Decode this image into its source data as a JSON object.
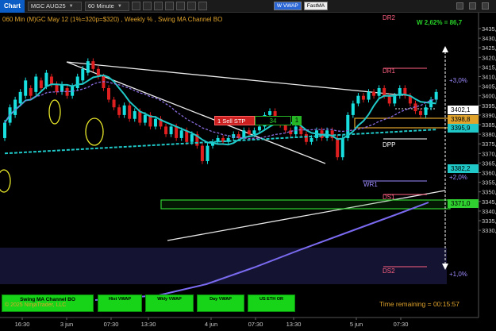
{
  "toolbar": {
    "title": "Chart",
    "instrument": "MGC AUG25",
    "timeframe": "60 Minute",
    "pill_a": "W VWAP",
    "pill_b": "FastMA"
  },
  "status_line": "060 Min  (M)GC May 12 (1%=320p=$320) , Weekly % , Swing MA Channel BO",
  "stats": "W 2,62% = 86,7",
  "order": {
    "sell_label": "1  Sell STP",
    "quantity": "34",
    "badge": "1"
  },
  "price_axis": {
    "labels": [
      "3435,0",
      "3430,0",
      "3425,0",
      "3420,0",
      "3415,0",
      "3410,0",
      "3405,0",
      "3400,0",
      "3395,0",
      "3390,0",
      "3385,0",
      "3380,0",
      "3375,0",
      "3370,0",
      "3365,0",
      "3360,0",
      "3355,0",
      "3350,0",
      "3345,0",
      "3340,0",
      "3335,0",
      "3330,0"
    ]
  },
  "price_markers": {
    "last_price": "3402,1",
    "stop_price": "3398,8",
    "ma_price": "3395,9",
    "channel_low": "3382,2",
    "s1_price": "3371,0"
  },
  "time_axis": {
    "labels": [
      "16:30",
      "3 jun",
      "07:30",
      "13:30",
      "4 jun",
      "07:30",
      "13:30",
      "5 jun",
      "07:30"
    ]
  },
  "levels": {
    "dr2": "DR2",
    "dr1": "DR1",
    "dpp": "DPP",
    "wr1": "WR1",
    "ds1": "DS1",
    "ds2": "DS2"
  },
  "projections": {
    "plus3": "+3,0%",
    "plus2": "+2,0%",
    "plus1": "+1,0%"
  },
  "bottom_buttons": {
    "swing": "Swing MA Channel BO",
    "hist_vwap": "Hist VWAP",
    "wkly_vwap": "Wkly VWAP",
    "day_vwap": "Day VWAP",
    "us_eth": "US ETH OR"
  },
  "copyright": "© 2025 NinjaTrader, LLC",
  "time_remaining": "Time remaining = 00:15:57",
  "colors": {
    "up_candle": "#18e0e0",
    "down_candle": "#e02020",
    "vwap": "#20c8c8",
    "fast_ma": "#8a6ce0",
    "weekly_vwap": "#7a6af0"
  }
}
